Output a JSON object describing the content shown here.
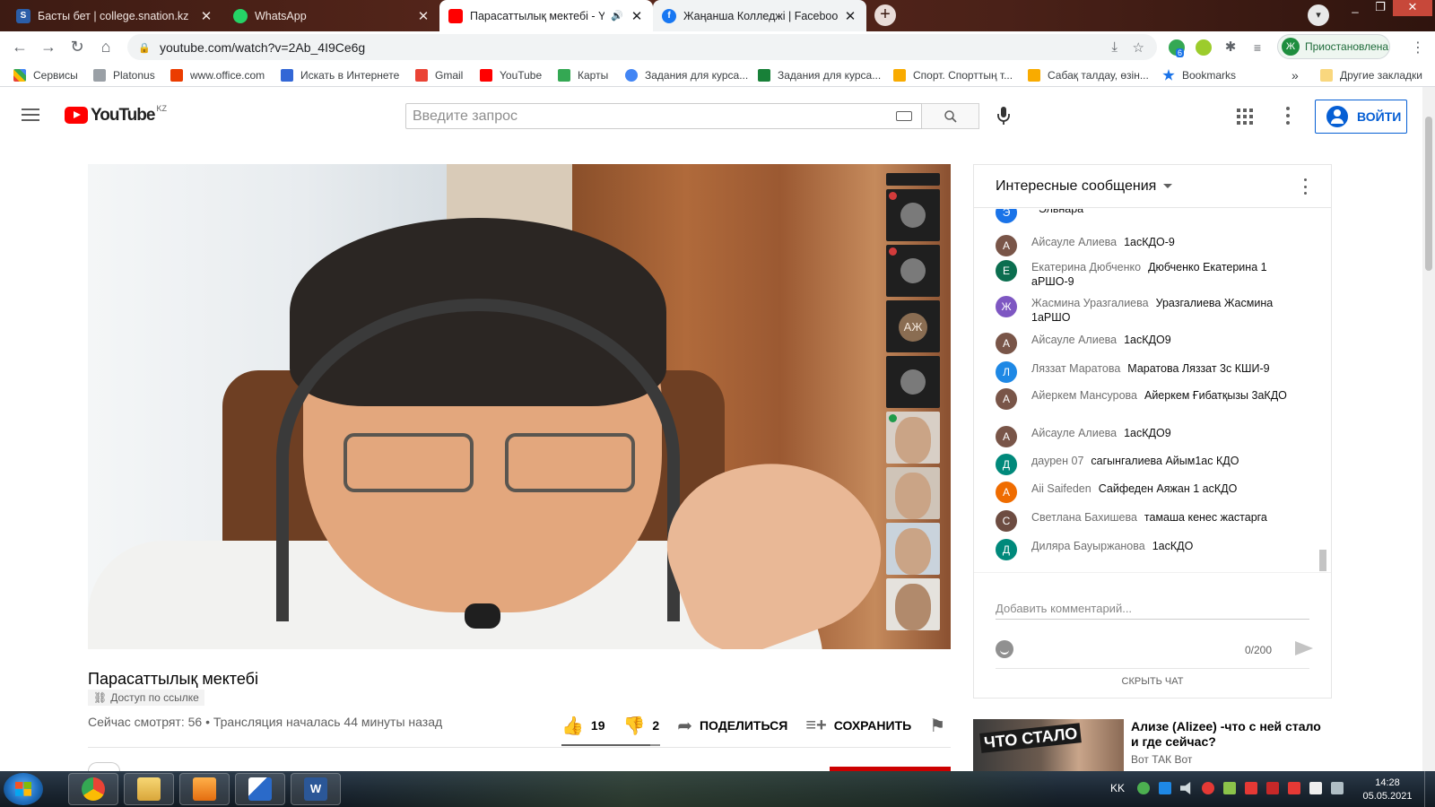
{
  "browser": {
    "tabs": [
      {
        "title": "Басты бет | college.snation.kz",
        "icon": "snation-favicon",
        "close": "✕"
      },
      {
        "title": "WhatsApp",
        "icon": "whatsapp-favicon",
        "close": "✕"
      },
      {
        "title": "Парасаттылық мектебі - YouTube",
        "icon": "youtube-favicon",
        "close": "✕",
        "audio": "🔊"
      },
      {
        "title": "Жаңанша Колледжі | Facebook",
        "icon": "facebook-favicon",
        "close": "✕"
      }
    ],
    "new_tab": "+",
    "url": "youtube.com/watch?v=2Ab_4I9Ce6g",
    "profile_status": "Приостановлена",
    "profile_initial": "Ж",
    "extension_badge": "6",
    "bookmarks": [
      {
        "label": "Сервисы",
        "color": "#e8453c"
      },
      {
        "label": "Platonus",
        "color": "#9aa0a6"
      },
      {
        "label": "www.office.com",
        "color": "#eb3c00"
      },
      {
        "label": "Искать в Интернете",
        "color": "#3367d6"
      },
      {
        "label": "Gmail",
        "color": "#ea4335"
      },
      {
        "label": "YouTube",
        "color": "#ff0000"
      },
      {
        "label": "Карты",
        "color": "#34a853"
      },
      {
        "label": "Задания для курса...",
        "color": "#4285f4"
      },
      {
        "label": "Задания для курса...",
        "color": "#188038"
      },
      {
        "label": "Спорт. Спорттың т...",
        "color": "#f9ab00"
      },
      {
        "label": "Сабақ талдау, өзін...",
        "color": "#f9ab00"
      },
      {
        "label": "Bookmarks",
        "color": "#1a73e8"
      }
    ],
    "bookmarks_more": "»",
    "other_bookmarks": "Другие закладки"
  },
  "youtube": {
    "logo_text": "YouTube",
    "country_code": "KZ",
    "search_placeholder": "Введите запрос",
    "sign_in": "ВОЙТИ"
  },
  "video": {
    "title": "Парасаттылық мектебі",
    "access": "Доступ по ссылке",
    "stats": "Сейчас смотрят: 56 • Трансляция началась 44 минуты назад",
    "likes": "19",
    "dislikes": "2",
    "share": "ПОДЕЛИТЬСЯ",
    "save": "СОХРАНИТЬ",
    "like_ratio": 0.9,
    "participant_initials": "АЖ"
  },
  "chat": {
    "header": "Интересные сообщения",
    "messages": [
      {
        "avatar": "Э",
        "color": "#1a73e8",
        "author": "",
        "text": "Эльнара"
      },
      {
        "avatar": "А",
        "color": "#795548",
        "author": "Айсауле Алиева",
        "text": "1асКДО-9"
      },
      {
        "avatar": "Е",
        "color": "#0b6e4f",
        "author": "Екатерина Дюбченко",
        "text": "Дюбченко Екатерина 1 аРШО-9"
      },
      {
        "avatar": "Ж",
        "color": "#7e57c2",
        "author": "Жасмина Уразгалиева",
        "text": "Уразгалиева Жасмина 1аРШО"
      },
      {
        "avatar": "А",
        "color": "#795548",
        "author": "Айсауле Алиева",
        "text": "1асКДО9"
      },
      {
        "avatar": "Л",
        "color": "#1e88e5",
        "author": "Ляззат Маратова",
        "text": "Маратова Ляззат 3с КШИ-9"
      },
      {
        "avatar": "А",
        "color": "#795548",
        "author": "Айеркем Мансурова",
        "text": "Айеркем Ғибатқызы 3аКДО"
      },
      {
        "avatar": "А",
        "color": "#795548",
        "author": "Айсауле Алиева",
        "text": "1асКДО9"
      },
      {
        "avatar": "Д",
        "color": "#00897b",
        "author": "даурен 07",
        "text": "сагынгалиева Айым1ас КДО"
      },
      {
        "avatar": "А",
        "color": "#ef6c00",
        "author": "Aii Saifeden",
        "text": "Сайфеден Аяжан 1 асКДО"
      },
      {
        "avatar": "С",
        "color": "#6d4c41",
        "author": "Светлана Бахишева",
        "text": "тамаша кенес жастарга"
      },
      {
        "avatar": "Д",
        "color": "#00897b",
        "author": "Диляра Бауыржанова",
        "text": "1асКДО"
      }
    ],
    "input_placeholder": "Добавить комментарий...",
    "counter": "0/200",
    "hide_chat": "СКРЫТЬ ЧАТ"
  },
  "recommended": {
    "thumb_text": "ЧТО СТАЛО",
    "title": "Ализе (Alizee) -что с ней стало и где сейчас?",
    "channel": "Вот ТАК Вот"
  },
  "taskbar": {
    "language": "KK",
    "time": "14:28",
    "date": "05.05.2021",
    "apps": [
      "chrome-icon",
      "explorer-icon",
      "media-player-icon",
      "network-app-icon",
      "word-icon"
    ]
  }
}
